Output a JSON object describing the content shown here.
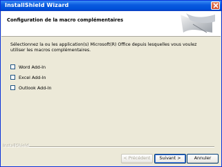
{
  "window": {
    "title": "InstallShield Wizard"
  },
  "header": {
    "title": "Configuration de la macro complémentaires"
  },
  "description": "Sélectionnez la ou les application(s) Microsoft(R) Office depuis lesquelles vous voulez utiliser les macros complémentaires.",
  "addins": [
    {
      "label": "Word Add-In",
      "checked": false
    },
    {
      "label": "Excel Add-In",
      "checked": false
    },
    {
      "label": "Outlook Add-In",
      "checked": false
    }
  ],
  "footer": {
    "brand": "InstallShield",
    "back_label": "< Précédent",
    "next_label": "Suivant >",
    "cancel_label": "Annuler"
  },
  "colors": {
    "title_bar": "#0a5be0",
    "close": "#d24b26",
    "face": "#ece9d8"
  },
  "icons": [
    "close-icon",
    "wizard-logo-icon"
  ]
}
